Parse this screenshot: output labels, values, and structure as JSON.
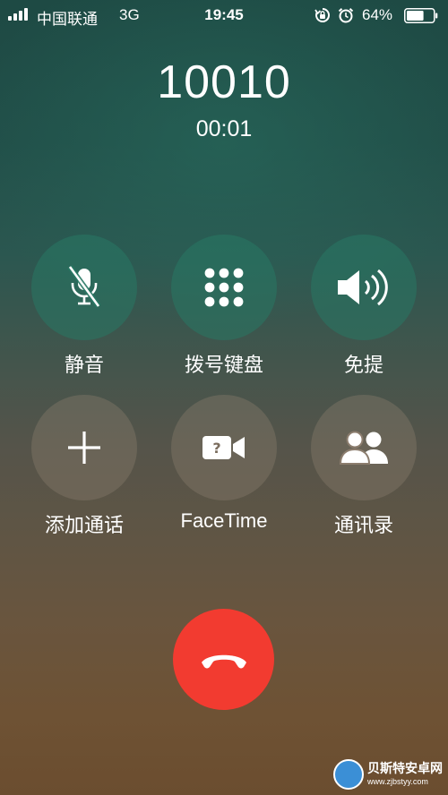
{
  "status_bar": {
    "carrier": "中国联通",
    "network": "3G",
    "time": "19:45",
    "battery_percent": "64%",
    "battery_level": 0.64,
    "icons": [
      "signal-icon",
      "rotation-lock-icon",
      "alarm-icon",
      "battery-icon"
    ]
  },
  "call": {
    "number": "10010",
    "duration": "00:01"
  },
  "controls": {
    "mute": {
      "label": "静音",
      "icon": "microphone-muted-icon"
    },
    "keypad": {
      "label": "拨号键盘",
      "icon": "keypad-icon"
    },
    "speaker": {
      "label": "免提",
      "icon": "speaker-icon"
    },
    "add_call": {
      "label": "添加通话",
      "icon": "plus-icon"
    },
    "facetime": {
      "label": "FaceTime",
      "icon": "video-camera-icon"
    },
    "contacts": {
      "label": "通讯录",
      "icon": "contacts-icon"
    }
  },
  "end_call": {
    "icon": "end-call-icon"
  },
  "watermark": {
    "title": "贝斯特安卓网",
    "url": "www.zjbstyy.com"
  },
  "colors": {
    "end_call_red": "#f23b30",
    "button_teal": "#28786a",
    "button_warm": "#8c7d6e"
  }
}
